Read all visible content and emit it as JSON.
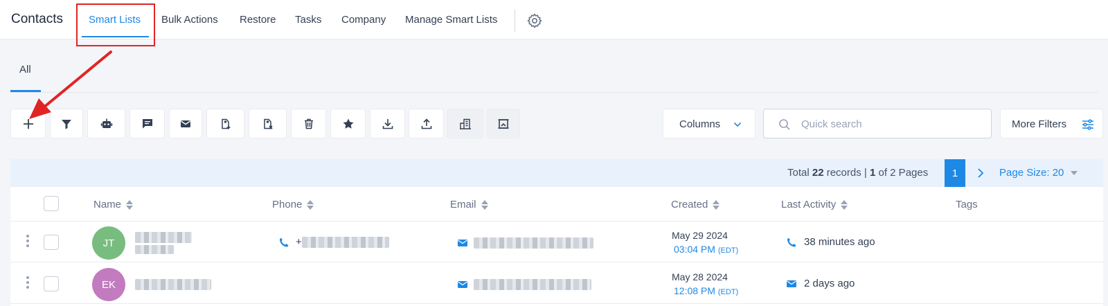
{
  "header": {
    "title": "Contacts",
    "nav": [
      "Smart Lists",
      "Bulk Actions",
      "Restore",
      "Tasks",
      "Company",
      "Manage Smart Lists"
    ],
    "active_nav": "Smart Lists"
  },
  "tabs": {
    "all_label": "All"
  },
  "toolbar": {
    "tools": [
      "add-icon",
      "filter-icon",
      "robot-icon",
      "message-icon",
      "email-icon",
      "tag-add-icon",
      "tag-remove-icon",
      "trash-icon",
      "star-icon",
      "download-icon",
      "upload-icon",
      "company-icon",
      "merge-icon"
    ],
    "columns_label": "Columns",
    "search_placeholder": "Quick search",
    "more_filters_label": "More Filters"
  },
  "pagination": {
    "total_prefix": "Total",
    "total_records": "22",
    "records_word": "records |",
    "current_page": "1",
    "of_pages_text": "of 2 Pages",
    "page_size_label": "Page Size: 20"
  },
  "table": {
    "columns": [
      "Name",
      "Phone",
      "Email",
      "Created",
      "Last Activity",
      "Tags"
    ],
    "rows": [
      {
        "initials": "JT",
        "avatar_color": "#79bc7f",
        "phone_prefix": "+",
        "created_date": "May 29 2024",
        "created_time": "03:04 PM",
        "timezone": "(EDT)",
        "activity_icon": "phone-icon",
        "last_activity": "38 minutes ago"
      },
      {
        "initials": "EK",
        "avatar_color": "#c27bbf",
        "created_date": "May 28 2024",
        "created_time": "12:08 PM",
        "timezone": "(EDT)",
        "activity_icon": "email-icon",
        "last_activity": "2 days ago"
      }
    ]
  },
  "colors": {
    "accent": "#1e88e5",
    "annotation": "#e02424"
  }
}
